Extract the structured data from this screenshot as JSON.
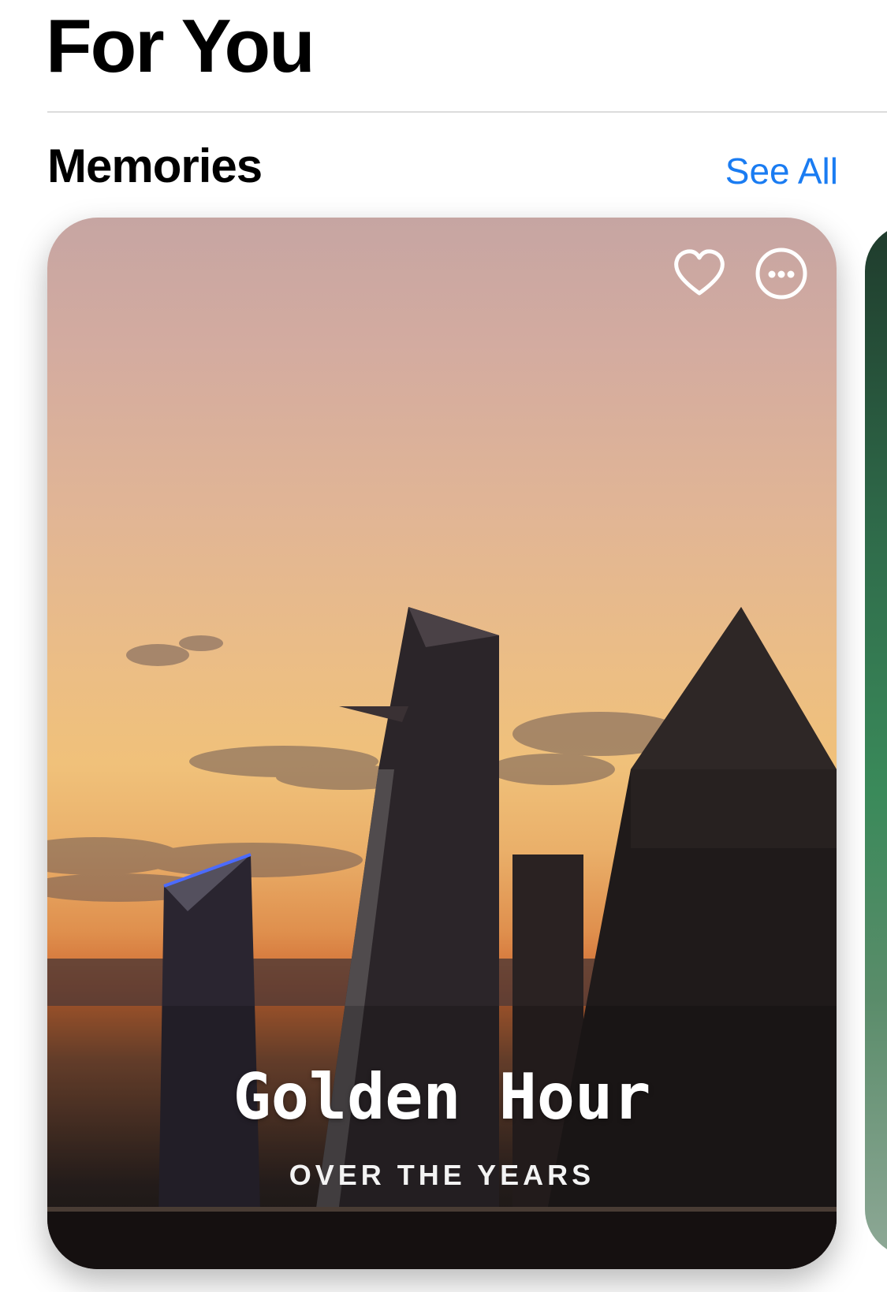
{
  "header": {
    "title": "For You"
  },
  "memories": {
    "section_title": "Memories",
    "see_all_label": "See All",
    "card": {
      "title": "Golden Hour",
      "subtitle": "OVER THE YEARS",
      "favorite_icon": "heart-outline-icon",
      "more_icon": "ellipsis-circle-icon"
    }
  },
  "colors": {
    "accent": "#1a7cf2",
    "text": "#000000"
  }
}
